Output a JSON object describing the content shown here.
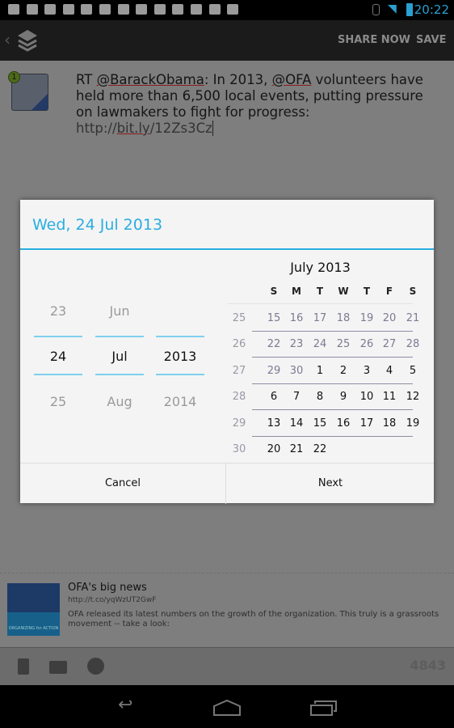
{
  "status_bar": {
    "time": "20:22",
    "icons": [
      "gmail-icon",
      "gallery-icon",
      "chat-icon",
      "trello-icon",
      "play-store-icon",
      "play-store-icon",
      "play-store-icon",
      "play-store-icon",
      "play-store-icon",
      "play-store-icon",
      "play-store-icon",
      "play-store-icon",
      "android-icon"
    ]
  },
  "action_bar": {
    "share_now": "SHARE NOW",
    "save": "SAVE",
    "logo": "buffer-layers-icon"
  },
  "compose": {
    "badge": "1",
    "tweet_parts": [
      "RT ",
      "@BarackObama",
      ": In 2013, ",
      "@OFA",
      " volunteers have held more than 6,500 local events, putting pressure on lawmakers to fight for progress: ",
      "http://",
      "bit.ly",
      "/12Zs3Cz"
    ]
  },
  "preview": {
    "title": "OFA's big news",
    "url": "http://t.co/yqWzUT2GwF",
    "description": "OFA released its latest numbers on the growth of the organization. This truly is a grassroots movement -- take a look:",
    "image_text": "ORGANIZING for ACTION"
  },
  "toolbar": {
    "char_count": "4843"
  },
  "dialog": {
    "title": "Wed, 24 Jul 2013",
    "pickers": {
      "day": [
        "23",
        "24",
        "25"
      ],
      "month": [
        "Jun",
        "Jul",
        "Aug"
      ],
      "year": [
        "",
        "2013",
        "2014"
      ]
    },
    "calendar": {
      "month": "July 2013",
      "weekdays": [
        "S",
        "M",
        "T",
        "W",
        "T",
        "F",
        "S"
      ],
      "weeks": [
        {
          "num": "25",
          "days": [
            "15",
            "16",
            "17",
            "18",
            "19",
            "20",
            "21"
          ],
          "current": [
            false,
            false,
            false,
            false,
            false,
            false,
            false
          ]
        },
        {
          "num": "26",
          "days": [
            "22",
            "23",
            "24",
            "25",
            "26",
            "27",
            "28"
          ],
          "current": [
            false,
            false,
            false,
            false,
            false,
            false,
            false
          ]
        },
        {
          "num": "27",
          "days": [
            "29",
            "30",
            "1",
            "2",
            "3",
            "4",
            "5"
          ],
          "current": [
            false,
            false,
            true,
            true,
            true,
            true,
            true
          ]
        },
        {
          "num": "28",
          "days": [
            "6",
            "7",
            "8",
            "9",
            "10",
            "11",
            "12"
          ],
          "current": [
            true,
            true,
            true,
            true,
            true,
            true,
            true
          ]
        },
        {
          "num": "29",
          "days": [
            "13",
            "14",
            "15",
            "16",
            "17",
            "18",
            "19"
          ],
          "current": [
            true,
            true,
            true,
            true,
            true,
            true,
            true
          ]
        },
        {
          "num": "30",
          "days": [
            "20",
            "21",
            "22",
            "",
            "",
            "",
            ""
          ],
          "current": [
            true,
            true,
            true,
            false,
            false,
            false,
            false
          ]
        }
      ]
    },
    "cancel": "Cancel",
    "next": "Next"
  },
  "colors": {
    "accent": "#2aaee0"
  }
}
